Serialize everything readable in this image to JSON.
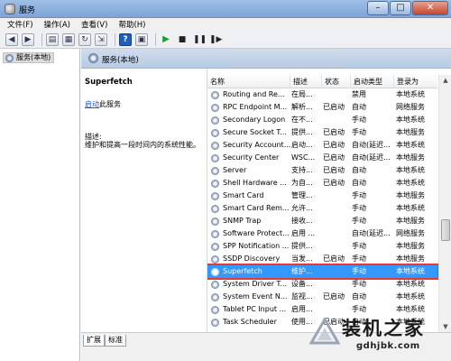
{
  "window": {
    "title": "服务",
    "minimize": "–",
    "maximize": "□",
    "close": "✕"
  },
  "menu": [
    "文件(F)",
    "操作(A)",
    "查看(V)",
    "帮助(H)"
  ],
  "tree": {
    "root": "服务(本地)"
  },
  "panel": {
    "header": "服务(本地)"
  },
  "description": {
    "service_name": "Superfetch",
    "start_link": "启动",
    "start_suffix": "此服务",
    "label": "描述:",
    "text": "维护和提高一段时间内的系统性能。"
  },
  "table": {
    "headers": [
      "名称",
      "描述",
      "状态",
      "启动类型",
      "登录为"
    ],
    "rows": [
      [
        "Routing and Re...",
        "在局...",
        "",
        "禁用",
        "本地系统"
      ],
      [
        "RPC Endpoint M...",
        "解析...",
        "已启动",
        "自动",
        "网络服务"
      ],
      [
        "Secondary Logon",
        "在不...",
        "",
        "手动",
        "本地系统"
      ],
      [
        "Secure Socket T...",
        "提供...",
        "已启动",
        "手动",
        "本地服务"
      ],
      [
        "Security Account...",
        "启动...",
        "已启动",
        "自动(延迟...",
        "本地系统"
      ],
      [
        "Security Center",
        "WSC...",
        "已启动",
        "自动(延迟...",
        "本地服务"
      ],
      [
        "Server",
        "支持...",
        "已启动",
        "自动",
        "本地系统"
      ],
      [
        "Shell Hardware ...",
        "为自...",
        "已启动",
        "自动",
        "本地系统"
      ],
      [
        "Smart Card",
        "管理...",
        "",
        "手动",
        "本地服务"
      ],
      [
        "Smart Card Rem...",
        "允许...",
        "",
        "手动",
        "本地系统"
      ],
      [
        "SNMP Trap",
        "接收...",
        "",
        "手动",
        "本地服务"
      ],
      [
        "Software Protect...",
        "启用 ...",
        "",
        "自动(延迟...",
        "网络服务"
      ],
      [
        "SPP Notification ...",
        "提供...",
        "",
        "手动",
        "本地服务"
      ],
      [
        "SSDP Discovery",
        "当发...",
        "已启动",
        "手动",
        "本地服务"
      ],
      [
        "Superfetch",
        "维护...",
        "",
        "手动",
        "本地系统"
      ],
      [
        "System Driver T...",
        "设备...",
        "",
        "手动",
        "本地系统"
      ],
      [
        "System Event N...",
        "监视...",
        "已启动",
        "自动",
        "本地系统"
      ],
      [
        "Tablet PC Input ...",
        "启用...",
        "",
        "手动",
        "本地系统"
      ],
      [
        "Task Scheduler",
        "使用...",
        "已启动",
        "自动",
        "本地系统"
      ]
    ],
    "selected_index": 14
  },
  "tabs": [
    "扩展",
    "标准"
  ],
  "watermark": {
    "title": "装机之家",
    "url": "gdhjbk.com"
  },
  "colors": {
    "selected_bg": "#3399ff",
    "highlight_border": "#e53935",
    "link": "#1f55c0"
  }
}
